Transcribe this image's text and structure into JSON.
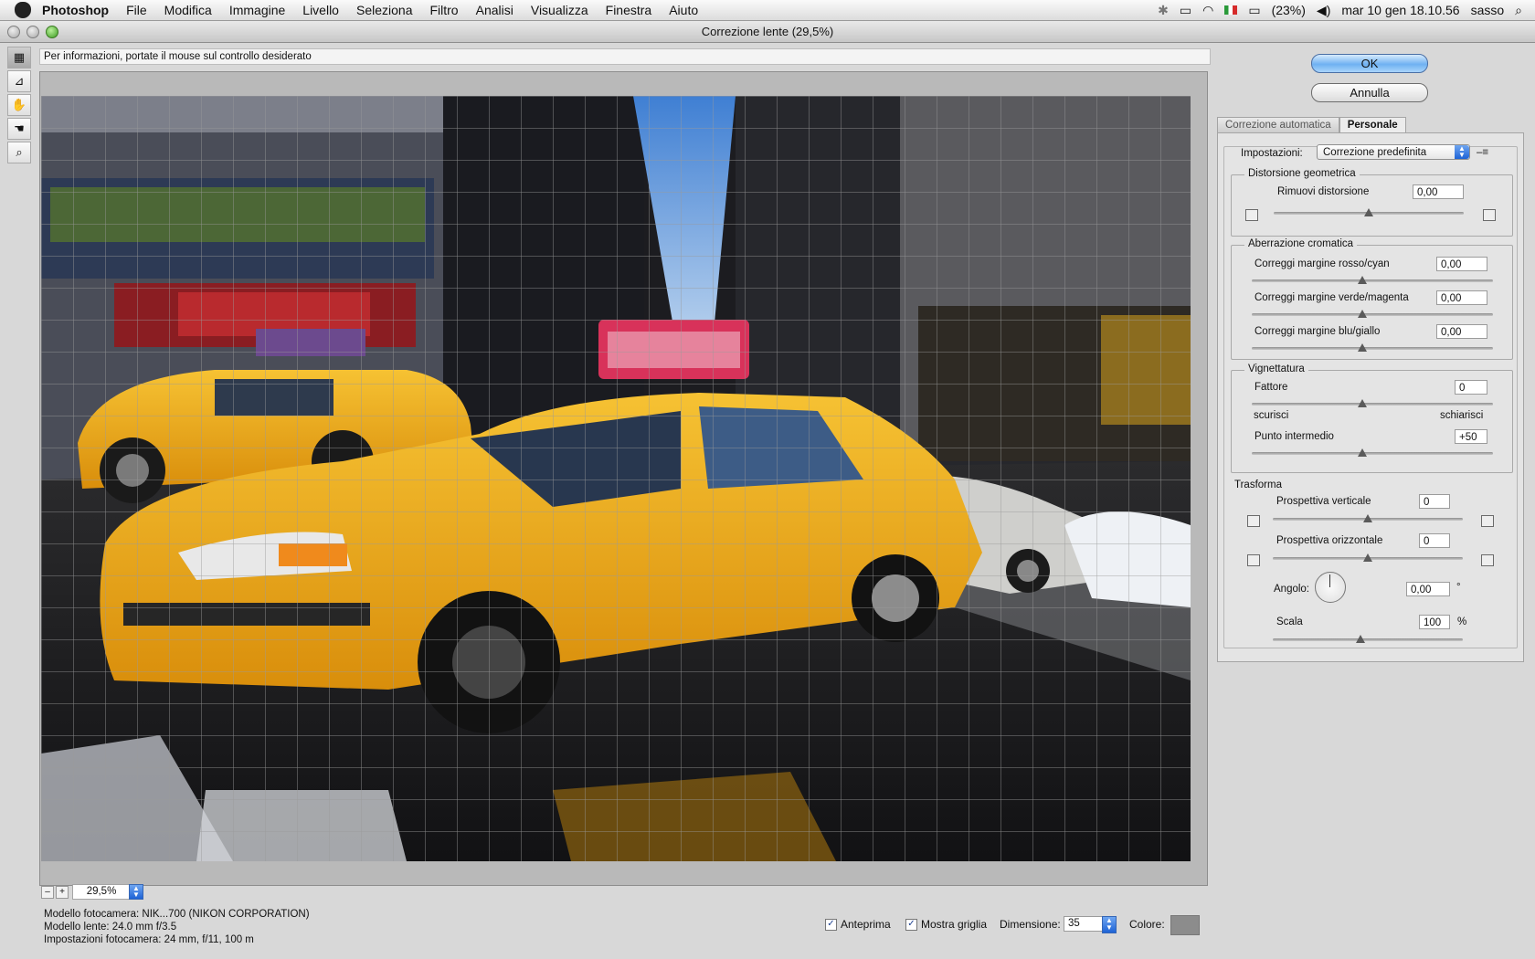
{
  "menubar": {
    "app": "Photoshop",
    "items": [
      "File",
      "Modifica",
      "Immagine",
      "Livello",
      "Seleziona",
      "Filtro",
      "Analisi",
      "Visualizza",
      "Finestra",
      "Aiuto"
    ],
    "battery": "(23%)",
    "datetime": "mar 10 gen  18.10.56",
    "user": "sasso"
  },
  "window": {
    "title": "Correzione lente (29,5%)"
  },
  "info": {
    "text": "Per informazioni, portate il mouse sul controllo desiderato"
  },
  "zoom": {
    "value": "29,5%",
    "minus": "–",
    "plus": "+"
  },
  "exif": {
    "camera": "Modello fotocamera: NIK...700 (NIKON CORPORATION)",
    "lens": "Modello lente: 24.0 mm f/3.5",
    "settings": "Impostazioni fotocamera: 24 mm, f/11, 100 m"
  },
  "bottom": {
    "preview_label": "Anteprima",
    "grid_label": "Mostra griglia",
    "size_label": "Dimensione:",
    "size_value": "35",
    "color_label": "Colore:",
    "grid_color": "#8c8c8c"
  },
  "buttons": {
    "ok": "OK",
    "cancel": "Annulla"
  },
  "tabs": {
    "auto": "Correzione automatica",
    "custom": "Personale"
  },
  "panel": {
    "settings_label": "Impostazioni:",
    "settings_value": "Correzione predefinita",
    "geometric": {
      "title": "Distorsione geometrica",
      "remove_label": "Rimuovi distorsione",
      "remove_value": "0,00"
    },
    "chromatic": {
      "title": "Aberrazione cromatica",
      "red_cyan_label": "Correggi margine rosso/cyan",
      "red_cyan_value": "0,00",
      "green_magenta_label": "Correggi margine verde/magenta",
      "green_magenta_value": "0,00",
      "blue_yellow_label": "Correggi margine blu/giallo",
      "blue_yellow_value": "0,00"
    },
    "vignette": {
      "title": "Vignettatura",
      "amount_label": "Fattore",
      "amount_value": "0",
      "darken": "scurisci",
      "lighten": "schiarisci",
      "midpoint_label": "Punto intermedio",
      "midpoint_value": "+50"
    },
    "transform": {
      "title": "Trasforma",
      "vertical_label": "Prospettiva verticale",
      "vertical_value": "0",
      "horizontal_label": "Prospettiva orizzontale",
      "horizontal_value": "0",
      "angle_label": "Angolo:",
      "angle_value": "0,00",
      "angle_unit": "°",
      "scale_label": "Scala",
      "scale_value": "100",
      "scale_unit": "%"
    }
  },
  "colors": {
    "accent": "#1e63d6",
    "taxi": "#f2b21a"
  }
}
